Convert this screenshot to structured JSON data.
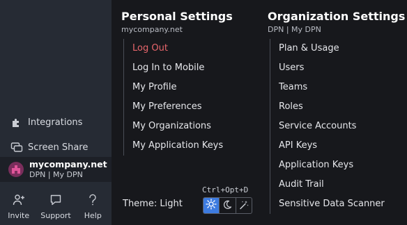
{
  "sidebar": {
    "items": [
      {
        "label": "Integrations",
        "icon": "puzzle-icon"
      },
      {
        "label": "Screen Share",
        "icon": "screen-share-icon"
      }
    ],
    "account": {
      "name": "mycompany.net",
      "sub": "DPN | My DPN"
    },
    "bottom": [
      {
        "label": "Invite",
        "icon": "add-user-icon"
      },
      {
        "label": "Support",
        "icon": "chat-icon"
      },
      {
        "label": "Help",
        "icon": "question-icon"
      }
    ]
  },
  "personal": {
    "title": "Personal Settings",
    "subtitle": "mycompany.net",
    "items": [
      "Log Out",
      "Log In to Mobile",
      "My Profile",
      "My Preferences",
      "My Organizations",
      "My Application Keys"
    ]
  },
  "organization": {
    "title": "Organization Settings",
    "subtitle": "DPN | My DPN",
    "items": [
      "Plan & Usage",
      "Users",
      "Teams",
      "Roles",
      "Service Accounts",
      "API Keys",
      "Application Keys",
      "Audit Trail",
      "Sensitive Data Scanner"
    ]
  },
  "theme": {
    "label": "Theme: Light",
    "shortcut": "Ctrl+Opt+D",
    "options": [
      "sun-icon",
      "moon-icon",
      "magic-wand-icon"
    ],
    "active": "sun-icon",
    "active_color": "#3d7be0"
  },
  "colors": {
    "logout": "#e8666c",
    "sidebar_bg": "#262b34",
    "menu_bg": "#17181c"
  }
}
